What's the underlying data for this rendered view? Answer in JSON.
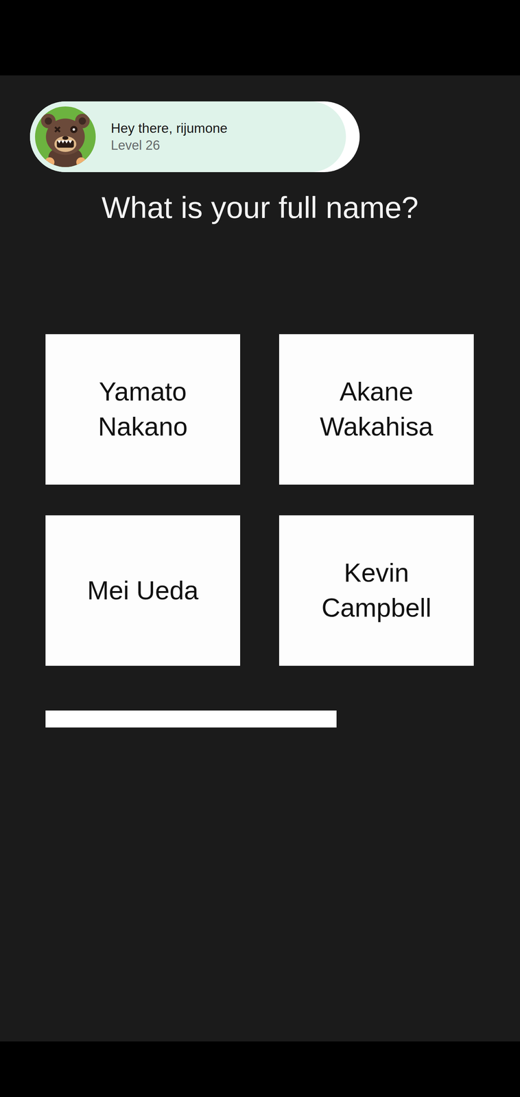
{
  "profile": {
    "greeting": "Hey there, rijumone",
    "level": "Level 26"
  },
  "question": "What is your full name?",
  "answers": [
    {
      "label": "Yamato Nakano"
    },
    {
      "label": "Akane Wakahisa"
    },
    {
      "label": "Mei Ueda"
    },
    {
      "label": "Kevin Campbell"
    }
  ],
  "timer": {
    "level": 0.68
  }
}
